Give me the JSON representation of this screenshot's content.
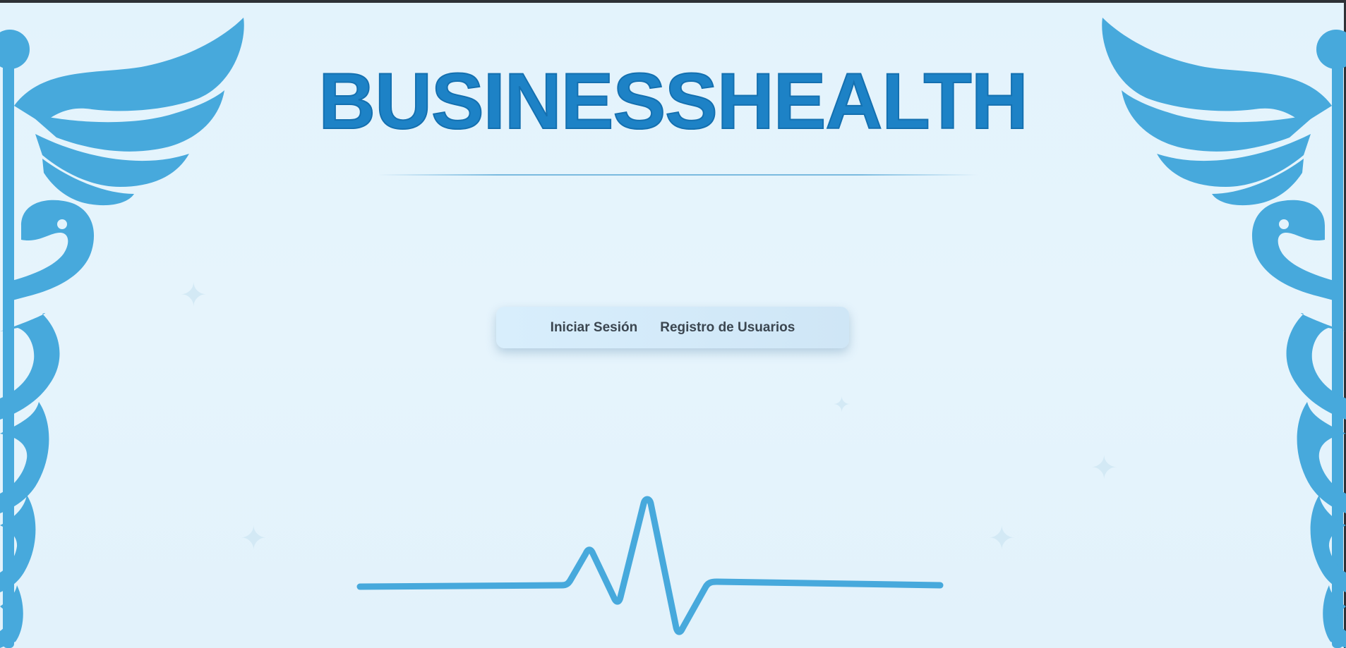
{
  "brand": {
    "title": "BUSINESSHEALTH"
  },
  "nav": {
    "items": [
      {
        "label": "Iniciar Sesión",
        "name": "nav-iniciar-sesion"
      },
      {
        "label": "Registro de Usuarios",
        "name": "nav-registro-usuarios"
      }
    ]
  },
  "decor": {
    "left_emblem": "caduceus-icon",
    "right_emblem": "caduceus-icon",
    "bottom_graphic": "heartbeat-line-icon"
  },
  "colors": {
    "background": "#e4f3fc",
    "title": "#1d82c6",
    "emblem": "#47a9dc",
    "nav_text": "#3b4650",
    "nav_bg": "#d5ebfa"
  }
}
